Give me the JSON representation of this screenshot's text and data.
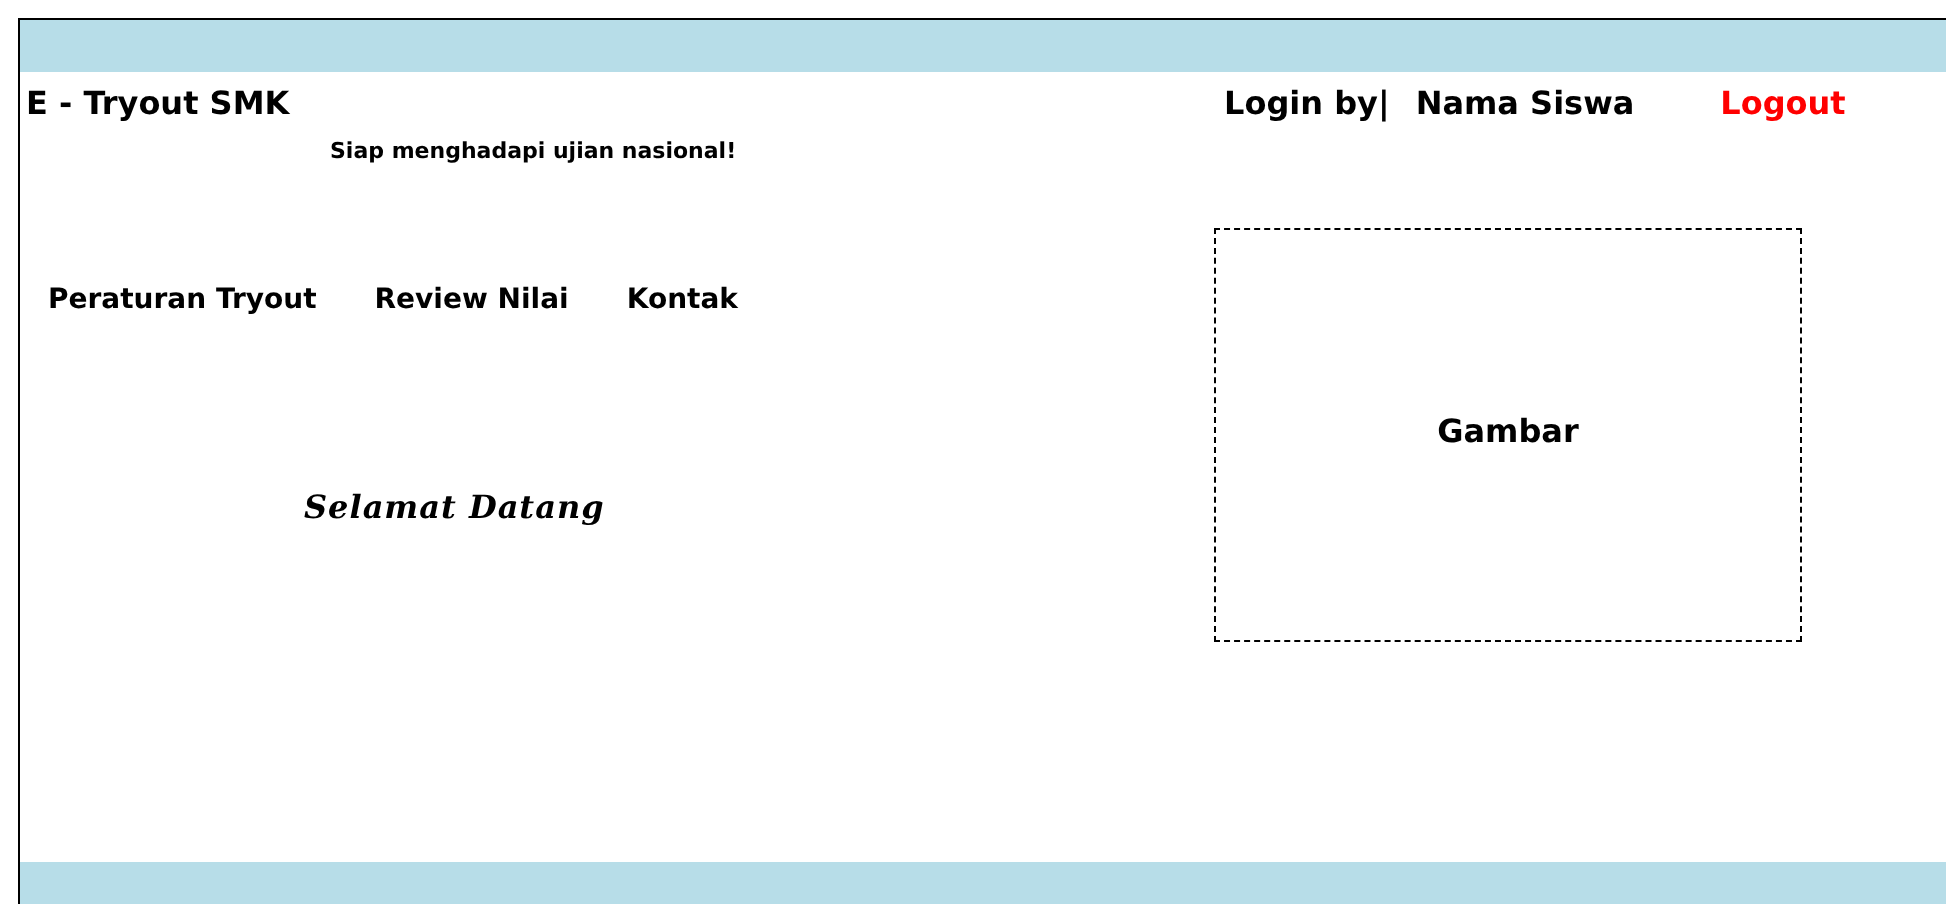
{
  "header": {
    "title": "E - Tryout SMK",
    "tagline": "Siap menghadapi ujian nasional!",
    "login_label": "Login by|",
    "user": "Nama Siswa",
    "logout": "Logout"
  },
  "nav": [
    {
      "label": "Peraturan Tryout"
    },
    {
      "label": "Review Nilai"
    },
    {
      "label": "Kontak"
    }
  ],
  "welcome": "Selamat Datang",
  "image_placeholder": "Gambar"
}
